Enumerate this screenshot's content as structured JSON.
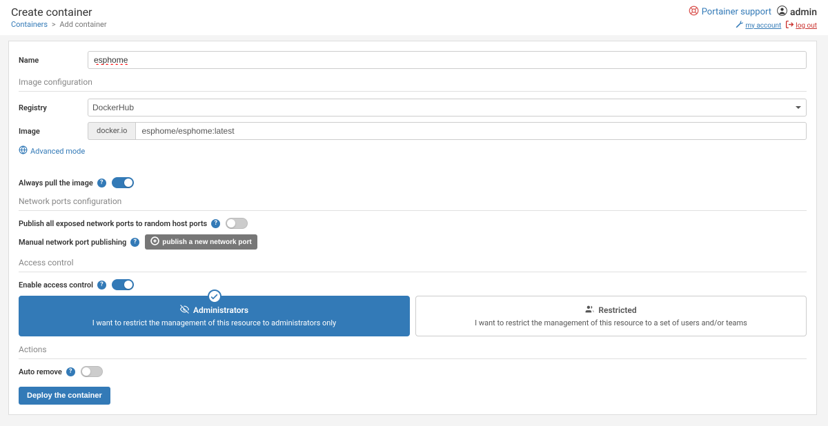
{
  "header": {
    "title": "Create container",
    "breadcrumb": {
      "parent": "Containers",
      "current": "Add container"
    },
    "support": "Portainer support",
    "user": "admin",
    "links": {
      "account": "my account",
      "logout": "log out"
    }
  },
  "form": {
    "name_label": "Name",
    "name_value": "esphome",
    "image_config_title": "Image configuration",
    "registry_label": "Registry",
    "registry_value": "DockerHub",
    "image_label": "Image",
    "image_prefix": "docker.io",
    "image_value": "esphome/esphome:latest",
    "advanced_mode": "Advanced mode",
    "always_pull": "Always pull the image",
    "network_ports_title": "Network ports configuration",
    "publish_all_label": "Publish all exposed network ports to random host ports",
    "manual_label": "Manual network port publishing",
    "publish_button": "publish a new network port",
    "access_control_title": "Access control",
    "enable_access_label": "Enable access control",
    "admin_card_title": "Administrators",
    "admin_card_desc": "I want to restrict the management of this resource to administrators only",
    "restricted_card_title": "Restricted",
    "restricted_card_desc": "I want to restrict the management of this resource to a set of users and/or teams",
    "actions_title": "Actions",
    "auto_remove_label": "Auto remove",
    "deploy_button": "Deploy the container"
  }
}
